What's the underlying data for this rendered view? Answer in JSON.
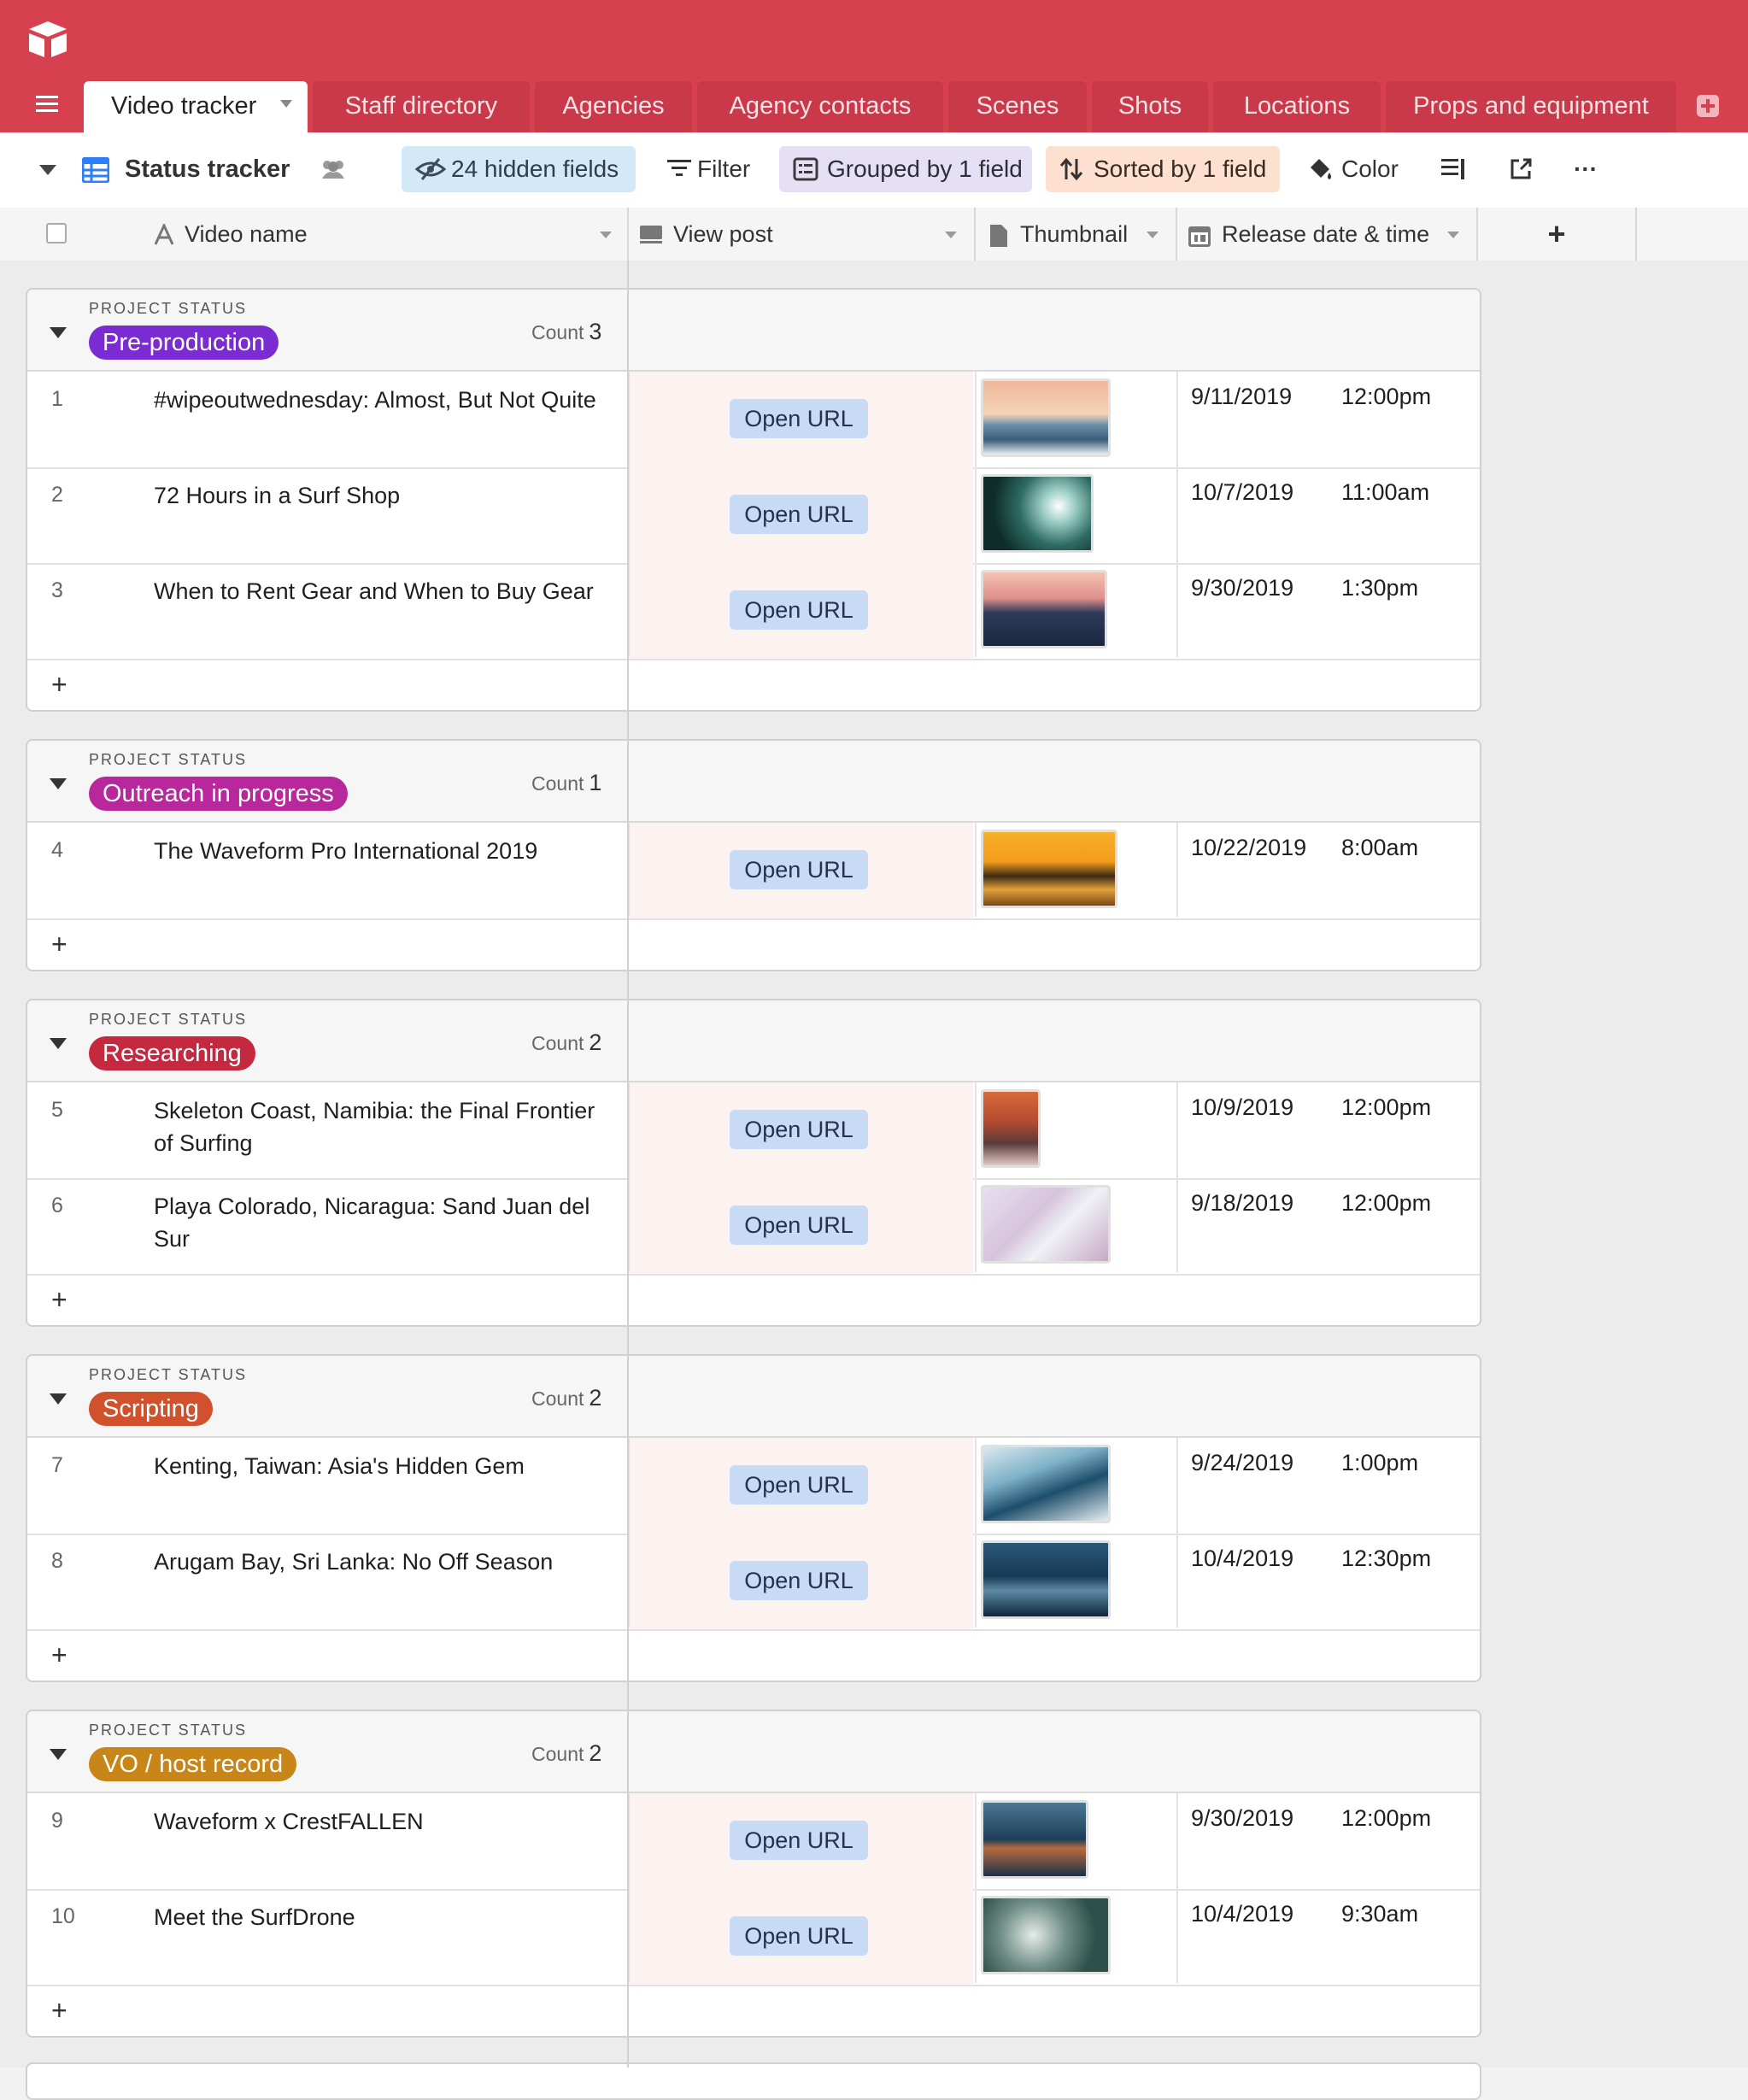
{
  "app": {
    "name": "Airtable"
  },
  "tabs": [
    {
      "label": "Video tracker",
      "active": true
    },
    {
      "label": "Staff directory"
    },
    {
      "label": "Agencies"
    },
    {
      "label": "Agency contacts"
    },
    {
      "label": "Scenes"
    },
    {
      "label": "Shots"
    },
    {
      "label": "Locations"
    },
    {
      "label": "Props and equipment"
    }
  ],
  "toolbar": {
    "view_name": "Status tracker",
    "hidden_fields": "24 hidden fields",
    "filter": "Filter",
    "grouped": "Grouped by 1 field",
    "sorted": "Sorted by 1 field",
    "color": "Color",
    "more": "···"
  },
  "columns": {
    "name": "Video name",
    "view": "View post",
    "thumb": "Thumbnail",
    "release": "Release date & time",
    "add": "+"
  },
  "group_label": "PROJECT STATUS",
  "count_label": "Count",
  "open_url": "Open URL",
  "add_row": "+",
  "colors": {
    "accent": "#d6404f",
    "pre": "#7a2bd1",
    "outreach": "#b8279b",
    "research": "#c4293f",
    "scripting": "#d0512c",
    "vo": "#c88518"
  },
  "groups": [
    {
      "status": "Pre-production",
      "color": "#7a2bd1",
      "count": "3",
      "rows": [
        {
          "num": "1",
          "name": "#wipeoutwednesday: Almost, But Not Quite",
          "date": "9/11/2019",
          "time": "12:00pm"
        },
        {
          "num": "2",
          "name": "72 Hours in a Surf Shop",
          "date": "10/7/2019",
          "time": "11:00am"
        },
        {
          "num": "3",
          "name": "When to Rent Gear and When to Buy Gear",
          "date": "9/30/2019",
          "time": "1:30pm"
        }
      ]
    },
    {
      "status": "Outreach in progress",
      "color": "#b8279b",
      "count": "1",
      "rows": [
        {
          "num": "4",
          "name": "The Waveform Pro International 2019",
          "date": "10/22/2019",
          "time": "8:00am"
        }
      ]
    },
    {
      "status": "Researching",
      "color": "#c4293f",
      "count": "2",
      "rows": [
        {
          "num": "5",
          "name": "Skeleton Coast, Namibia: the Final Frontier of Surfing",
          "date": "10/9/2019",
          "time": "12:00pm"
        },
        {
          "num": "6",
          "name": "Playa Colorado, Nicaragua: Sand Juan del Sur",
          "date": "9/18/2019",
          "time": "12:00pm"
        }
      ]
    },
    {
      "status": "Scripting",
      "color": "#d0512c",
      "count": "2",
      "rows": [
        {
          "num": "7",
          "name": "Kenting, Taiwan: Asia's Hidden Gem",
          "date": "9/24/2019",
          "time": "1:00pm"
        },
        {
          "num": "8",
          "name": "Arugam Bay, Sri Lanka: No Off Season",
          "date": "10/4/2019",
          "time": "12:30pm"
        }
      ]
    },
    {
      "status": "VO / host record",
      "color": "#c88518",
      "count": "2",
      "rows": [
        {
          "num": "9",
          "name": "Waveform x CrestFALLEN",
          "date": "9/30/2019",
          "time": "12:00pm"
        },
        {
          "num": "10",
          "name": "Meet the SurfDrone",
          "date": "10/4/2019",
          "time": "9:30am"
        }
      ]
    }
  ]
}
